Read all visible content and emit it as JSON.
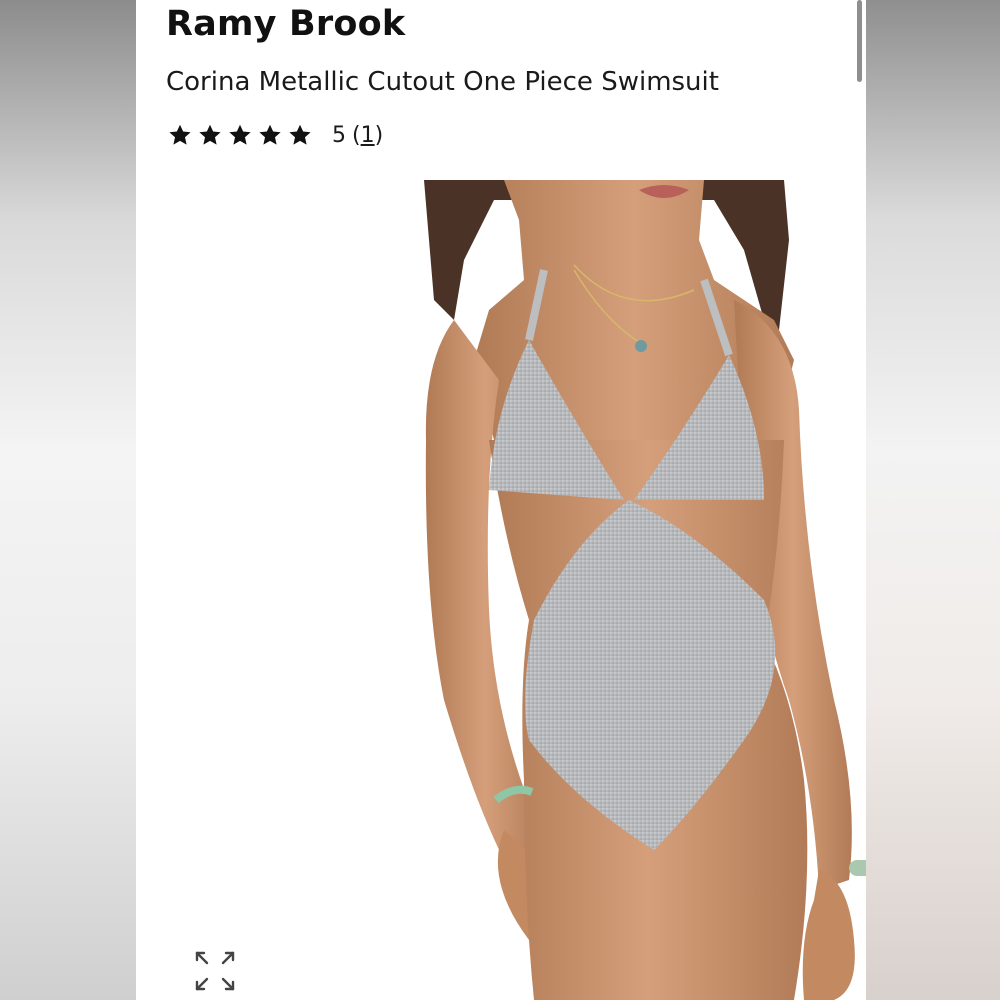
{
  "product": {
    "brand": "Ramy Brook",
    "name": "Corina Metallic Cutout One Piece Swimsuit",
    "rating": {
      "stars_filled": 5,
      "stars_total": 5,
      "value": "5",
      "open_paren": "(",
      "review_count": "1",
      "close_paren": ")"
    }
  },
  "image": {
    "alt": "Model wearing silver metallic cutout one-piece swimsuit"
  },
  "icons": {
    "star": "star-icon",
    "expand": "expand-icon"
  },
  "colors": {
    "text": "#111111",
    "star": "#111111",
    "swimsuit": "#b9bbbe",
    "skin": "#c9906a",
    "bracelet": "#9cc7a8"
  }
}
